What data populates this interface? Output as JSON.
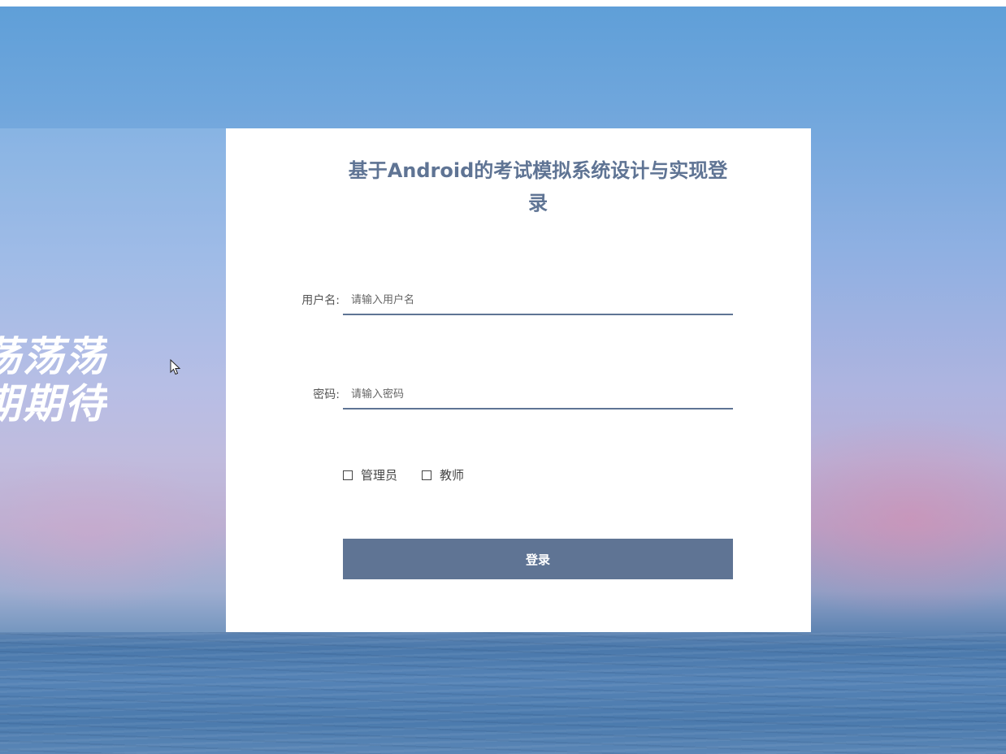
{
  "slogan": {
    "line1": "荡荡荡",
    "line2": "期期待"
  },
  "login": {
    "title": "基于Android的考试模拟系统设计与实现登录",
    "username_label": "用户名:",
    "username_placeholder": "请输入用户名",
    "username_value": "",
    "password_label": "密码:",
    "password_placeholder": "请输入密码",
    "password_value": "",
    "roles": [
      {
        "label": "管理员",
        "checked": false
      },
      {
        "label": "教师",
        "checked": false
      }
    ],
    "submit_label": "登录"
  },
  "colors": {
    "accent": "#5f7494",
    "card": "#ffffff"
  }
}
